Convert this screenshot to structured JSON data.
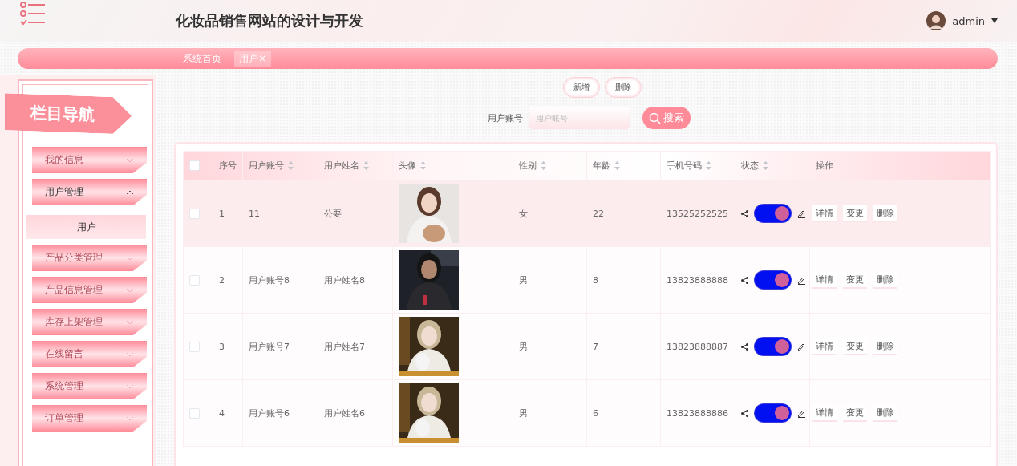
{
  "header": {
    "title": "化妆品销售网站的设计与开发",
    "user": "admin"
  },
  "breadcrumbs": [
    {
      "label": "系统首页",
      "selected": false
    },
    {
      "label": "用户",
      "selected": true,
      "close": "×"
    }
  ],
  "sidebar": {
    "title": "栏目导航",
    "items": [
      {
        "label": "我的信息",
        "expanded": false
      },
      {
        "label": "用户管理",
        "expanded": true,
        "children": [
          {
            "label": "用户",
            "selected": true
          }
        ]
      },
      {
        "label": "产品分类管理",
        "expanded": false
      },
      {
        "label": "产品信息管理",
        "expanded": false
      },
      {
        "label": "库存上架管理",
        "expanded": false
      },
      {
        "label": "在线留言",
        "expanded": false
      },
      {
        "label": "系统管理",
        "expanded": false
      },
      {
        "label": "订单管理",
        "expanded": false
      }
    ]
  },
  "toolbar": {
    "buttons": [
      "新增",
      "删除"
    ],
    "search": {
      "label": "用户账号",
      "placeholder": "用户账号",
      "button": "搜索"
    }
  },
  "table": {
    "select_all": {
      "checked": false
    },
    "columns": [
      {
        "label": "序号",
        "sortable": false
      },
      {
        "label": "用户账号",
        "sortable": true
      },
      {
        "label": "用户姓名",
        "sortable": true
      },
      {
        "label": "头像",
        "sortable": true
      },
      {
        "label": "性别",
        "sortable": true
      },
      {
        "label": "年龄",
        "sortable": true
      },
      {
        "label": "手机号码",
        "sortable": true
      },
      {
        "label": "状态",
        "sortable": true
      },
      {
        "label": "操作",
        "sortable": false
      }
    ],
    "rows": [
      {
        "index": "1",
        "account": "11",
        "name": "公要",
        "gender": "女",
        "age": "22",
        "phone": "13525252525",
        "checked": false,
        "highlighted": true,
        "status_on": true,
        "actions": [
          "详情",
          "变更",
          "删除"
        ]
      },
      {
        "index": "2",
        "account": "用户账号8",
        "name": "用户姓名8",
        "gender": "男",
        "age": "8",
        "phone": "13823888888",
        "checked": false,
        "highlighted": false,
        "status_on": true,
        "actions": [
          "详情",
          "变更",
          "删除"
        ]
      },
      {
        "index": "3",
        "account": "用户账号7",
        "name": "用户姓名7",
        "gender": "男",
        "age": "7",
        "phone": "13823888887",
        "checked": false,
        "highlighted": false,
        "status_on": true,
        "actions": [
          "详情",
          "变更",
          "删除"
        ]
      },
      {
        "index": "4",
        "account": "用户账号6",
        "name": "用户姓名6",
        "gender": "男",
        "age": "6",
        "phone": "13823888886",
        "checked": false,
        "highlighted": false,
        "status_on": true,
        "actions": [
          "详情",
          "变更",
          "删除"
        ]
      }
    ]
  }
}
